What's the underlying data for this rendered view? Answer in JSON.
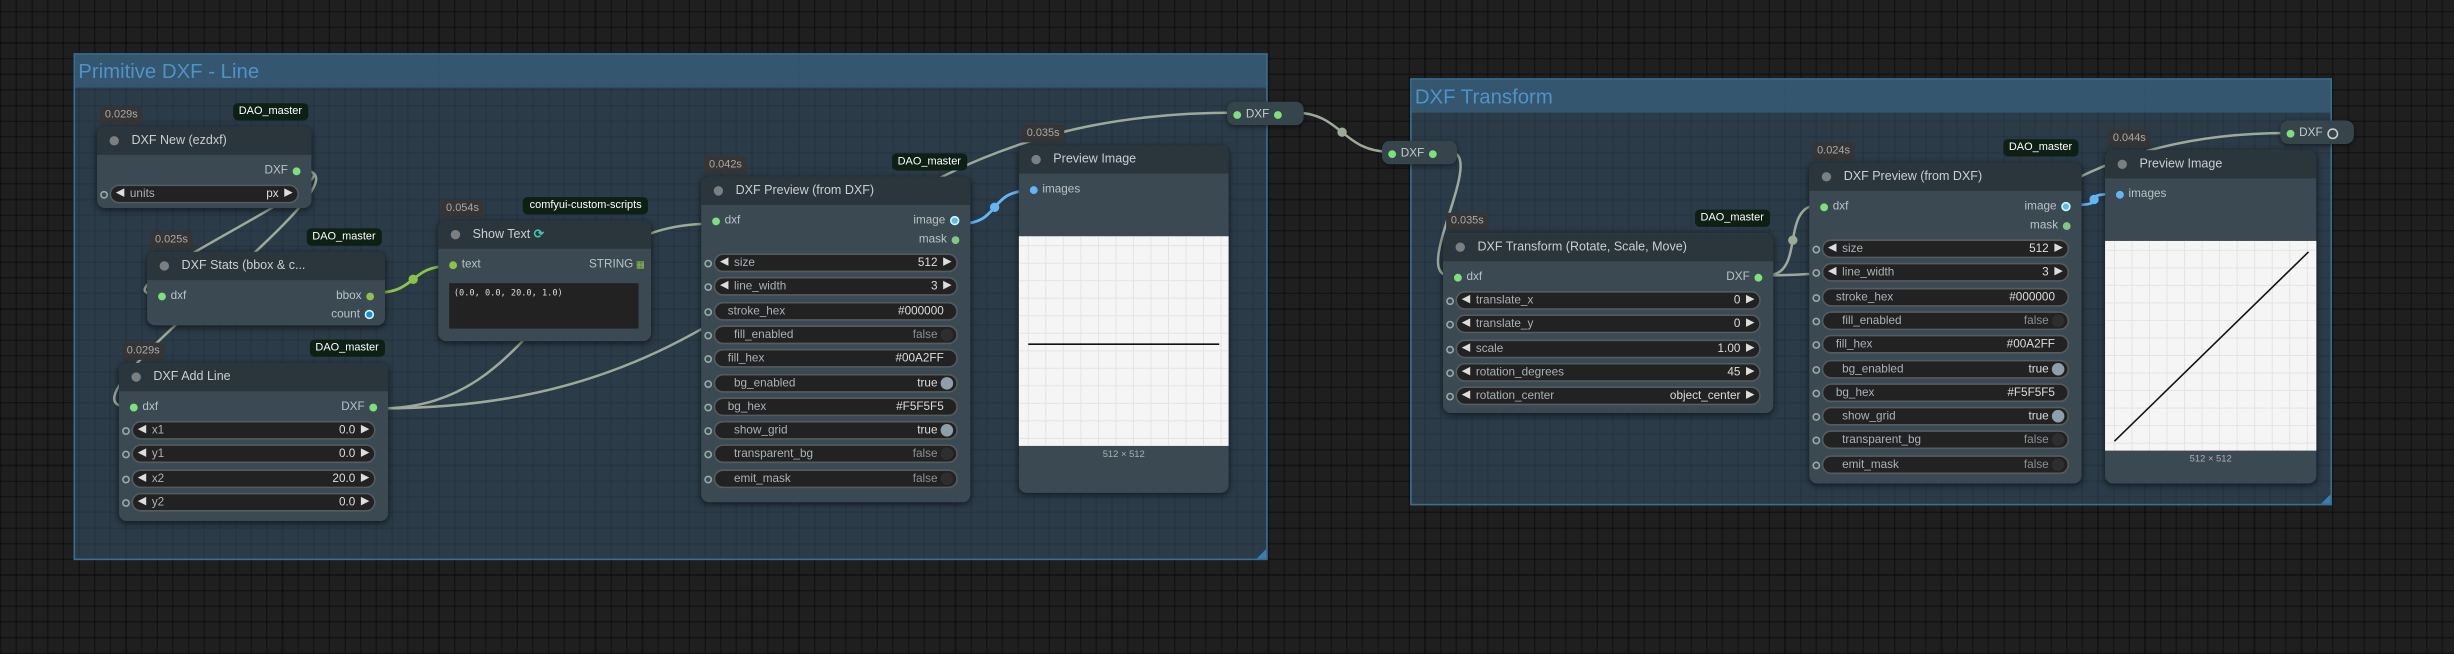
{
  "groups": [
    {
      "title": "Primitive DXF - Line"
    },
    {
      "title": "DXF Transform"
    }
  ],
  "colors": {
    "dxf": "#7CE07C",
    "image": "#64B5F6",
    "mask": "#81C784",
    "bbox": "#8BC34A",
    "count": "#1E88E5",
    "string": "#8BC34A",
    "link": "#9DAA99",
    "link_bbox": "#8BC34A",
    "link_image": "#64B5F6",
    "group_title": "#4F93C6"
  },
  "nodes": [
    {
      "title": "DXF New (ezdxf)",
      "time": "0.029s",
      "author": "DAO_master",
      "slots": [
        {
          "out": {
            "name": "DXF",
            "color": "dxf"
          }
        }
      ],
      "widgets": [
        {
          "type": "combo",
          "name": "units",
          "value": "px"
        }
      ]
    },
    {
      "title": "DXF Stats (bbox & c...",
      "time": "0.025s",
      "author": "DAO_master",
      "slots": [
        {
          "in": {
            "name": "dxf",
            "color": "dxf"
          },
          "out": {
            "name": "bbox",
            "color": "bbox"
          }
        },
        {
          "out": {
            "name": "count",
            "color": "count"
          }
        }
      ],
      "widgets": []
    },
    {
      "title": "DXF Add Line",
      "time": "0.029s",
      "author": "DAO_master",
      "slots": [
        {
          "in": {
            "name": "dxf",
            "color": "dxf"
          },
          "out": {
            "name": "DXF",
            "color": "dxf"
          }
        }
      ],
      "widgets": [
        {
          "type": "number",
          "name": "x1",
          "value": "0.0"
        },
        {
          "type": "number",
          "name": "y1",
          "value": "0.0"
        },
        {
          "type": "number",
          "name": "x2",
          "value": "20.0"
        },
        {
          "type": "number",
          "name": "y2",
          "value": "0.0"
        }
      ]
    },
    {
      "title": "Show Text",
      "time": "0.054s",
      "author": "comfyui-custom-scripts",
      "title_icon": "snake-link-icon",
      "slots": [
        {
          "in": {
            "name": "text",
            "color": "bbox"
          },
          "out": {
            "name": "STRING",
            "color": "string",
            "icon": "grid-icon"
          }
        }
      ],
      "widgets": [],
      "text_output": "(0.0, 0.0, 20.0, 1.0)"
    },
    {
      "title": "DXF Preview (from DXF)",
      "time": "0.042s",
      "author": "DAO_master",
      "slots": [
        {
          "in": {
            "name": "dxf",
            "color": "dxf"
          },
          "out": {
            "name": "image",
            "color": "image"
          }
        },
        {
          "out": {
            "name": "mask",
            "color": "mask"
          }
        }
      ],
      "widgets": [
        {
          "type": "number",
          "name": "size",
          "value": "512"
        },
        {
          "type": "number",
          "name": "line_width",
          "value": "3"
        },
        {
          "type": "text",
          "name": "stroke_hex",
          "value": "#000000"
        },
        {
          "type": "toggle",
          "name": "fill_enabled",
          "value": "false"
        },
        {
          "type": "text",
          "name": "fill_hex",
          "value": "#00A2FF"
        },
        {
          "type": "toggle",
          "name": "bg_enabled",
          "value": "true"
        },
        {
          "type": "text",
          "name": "bg_hex",
          "value": "#F5F5F5"
        },
        {
          "type": "toggle",
          "name": "show_grid",
          "value": "true"
        },
        {
          "type": "toggle",
          "name": "transparent_bg",
          "value": "false"
        },
        {
          "type": "toggle",
          "name": "emit_mask",
          "value": "false"
        }
      ]
    },
    {
      "title": "Preview Image",
      "time": "0.035s",
      "slots": [
        {
          "in": {
            "name": "images",
            "color": "image"
          }
        }
      ],
      "widgets": [],
      "preview": {
        "size_label": "512 × 512",
        "line": "horizontal"
      }
    },
    {
      "title": "DXF Transform (Rotate, Scale, Move)",
      "time": "0.035s",
      "author": "DAO_master",
      "slots": [
        {
          "in": {
            "name": "dxf",
            "color": "dxf"
          },
          "out": {
            "name": "DXF",
            "color": "dxf"
          }
        }
      ],
      "widgets": [
        {
          "type": "number",
          "name": "translate_x",
          "value": "0"
        },
        {
          "type": "number",
          "name": "translate_y",
          "value": "0"
        },
        {
          "type": "number",
          "name": "scale",
          "value": "1.00"
        },
        {
          "type": "number",
          "name": "rotation_degrees",
          "value": "45"
        },
        {
          "type": "combo",
          "name": "rotation_center",
          "value": "object_center"
        }
      ]
    },
    {
      "title": "DXF Preview (from DXF)",
      "time": "0.024s",
      "author": "DAO_master",
      "slots": [
        {
          "in": {
            "name": "dxf",
            "color": "dxf"
          },
          "out": {
            "name": "image",
            "color": "image"
          }
        },
        {
          "out": {
            "name": "mask",
            "color": "mask"
          }
        }
      ],
      "widgets": [
        {
          "type": "number",
          "name": "size",
          "value": "512"
        },
        {
          "type": "number",
          "name": "line_width",
          "value": "3"
        },
        {
          "type": "text",
          "name": "stroke_hex",
          "value": "#000000"
        },
        {
          "type": "toggle",
          "name": "fill_enabled",
          "value": "false"
        },
        {
          "type": "text",
          "name": "fill_hex",
          "value": "#00A2FF"
        },
        {
          "type": "toggle",
          "name": "bg_enabled",
          "value": "true"
        },
        {
          "type": "text",
          "name": "bg_hex",
          "value": "#F5F5F5"
        },
        {
          "type": "toggle",
          "name": "show_grid",
          "value": "true"
        },
        {
          "type": "toggle",
          "name": "transparent_bg",
          "value": "false"
        },
        {
          "type": "toggle",
          "name": "emit_mask",
          "value": "false"
        }
      ]
    },
    {
      "title": "Preview Image",
      "time": "0.044s",
      "slots": [
        {
          "in": {
            "name": "images",
            "color": "image"
          }
        }
      ],
      "widgets": [],
      "preview": {
        "size_label": "512 × 512",
        "line": "diagonal"
      }
    }
  ],
  "reroutes": [
    {
      "label": "DXF"
    },
    {
      "label": "DXF"
    },
    {
      "label": "DXF"
    }
  ]
}
